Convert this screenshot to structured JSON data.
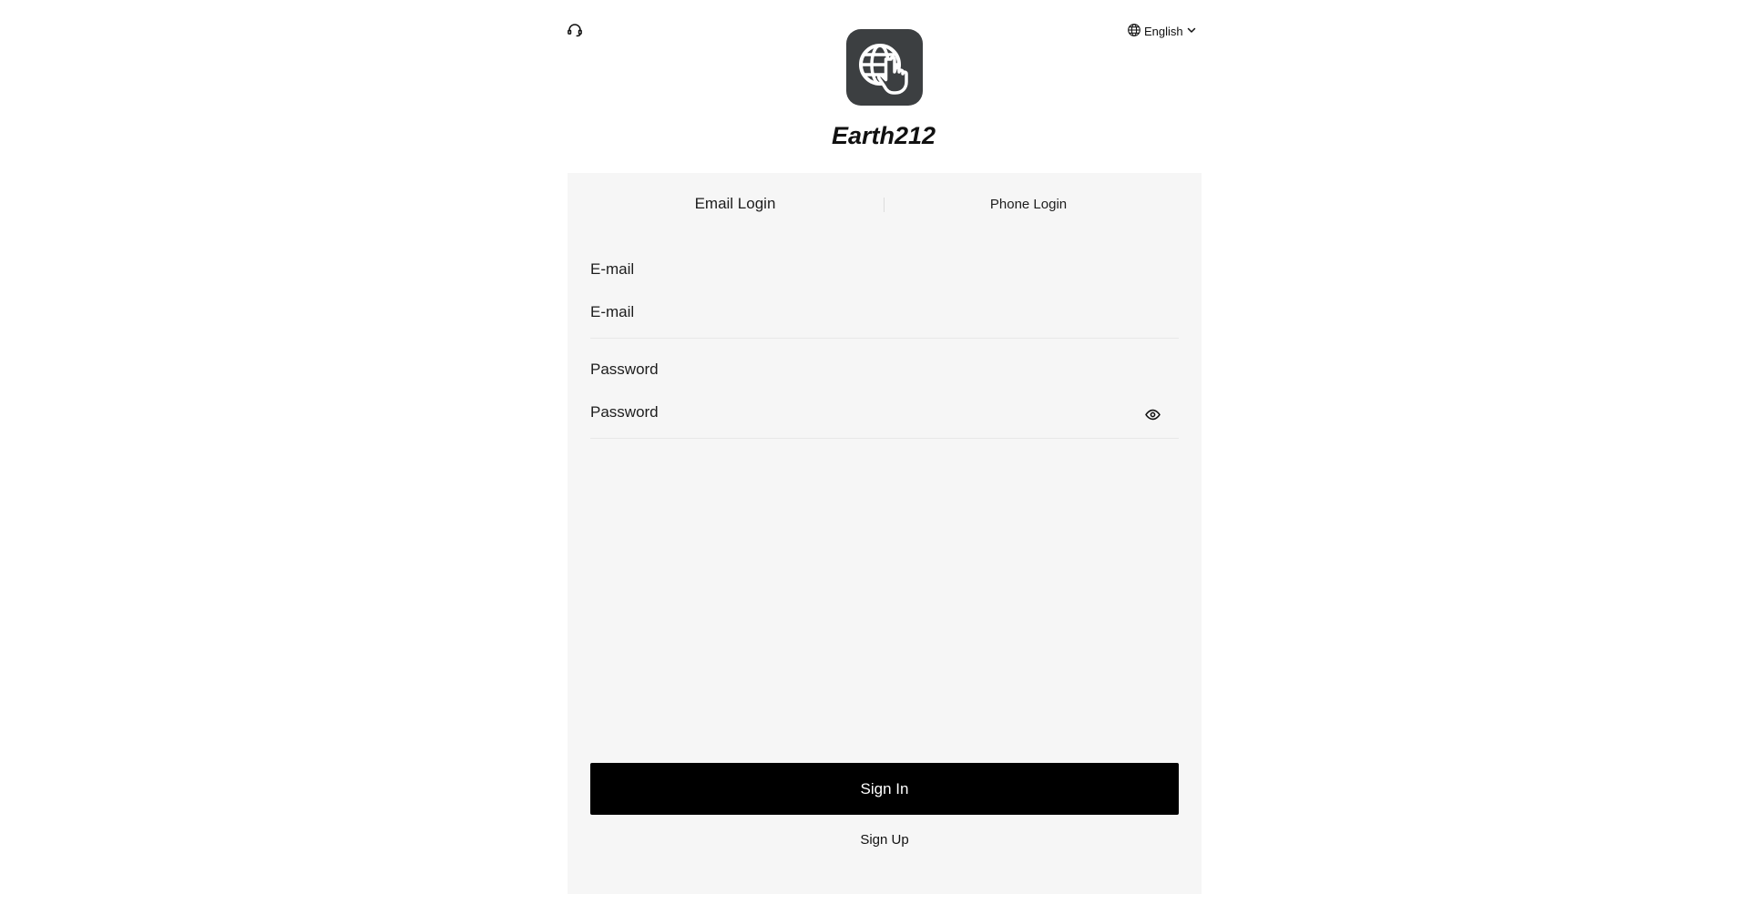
{
  "header": {
    "support_icon": "headset-icon",
    "language": {
      "icon": "globe-icon",
      "label": "English",
      "chevron": "chevron-down-icon"
    }
  },
  "app": {
    "logo_icon": "globe-pointer-icon",
    "title": "Earth212"
  },
  "tabs": [
    {
      "label": "Email Login",
      "active": true
    },
    {
      "label": "Phone Login",
      "active": false
    }
  ],
  "form": {
    "email": {
      "label": "E-mail",
      "placeholder": "E-mail",
      "value": ""
    },
    "password": {
      "label": "Password",
      "placeholder": "Password",
      "value": "",
      "toggle_icon": "eye-icon"
    }
  },
  "actions": {
    "sign_in_label": "Sign In",
    "sign_up_label": "Sign Up"
  },
  "colors": {
    "panel_bg": "#f6f6f6",
    "primary_button": "#000000",
    "logo_bg": "#3c3f41"
  }
}
